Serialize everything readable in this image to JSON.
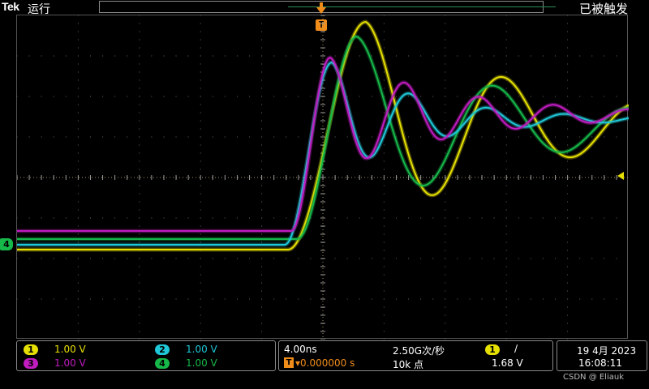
{
  "header": {
    "brand": "Tek",
    "run_status": "运行",
    "trigger_status": "已被触发"
  },
  "markers": {
    "trigger_position_label": "T",
    "channel4_ground_label": "4"
  },
  "channels": [
    {
      "id": "1",
      "label": "1",
      "scale": "1.00 V",
      "color": "#e6e000"
    },
    {
      "id": "2",
      "label": "2",
      "scale": "1.00 V",
      "color": "#1fc8d8"
    },
    {
      "id": "3",
      "label": "3",
      "scale": "1.00 V",
      "color": "#c01cc0"
    },
    {
      "id": "4",
      "label": "4",
      "scale": "1.00 V",
      "color": "#16b84a"
    }
  ],
  "timebase": {
    "scale": "4.00ns",
    "sample_rate": "2.50G次/秒",
    "trigger_delay_icon": "T",
    "delay": "▾0.000000 s",
    "record_length": "10k 点"
  },
  "trigger": {
    "source": "1",
    "slope": "∕",
    "level": "1.68 V"
  },
  "datetime": {
    "date": "19 4月 2023",
    "time": "16:08:11"
  },
  "watermark": "CSDN @ Eliauk",
  "icons": {
    "trigger_arrow": "orange-down-arrow",
    "trigger_level": "yellow-left-arrow",
    "slope": "rising-edge-icon"
  }
}
